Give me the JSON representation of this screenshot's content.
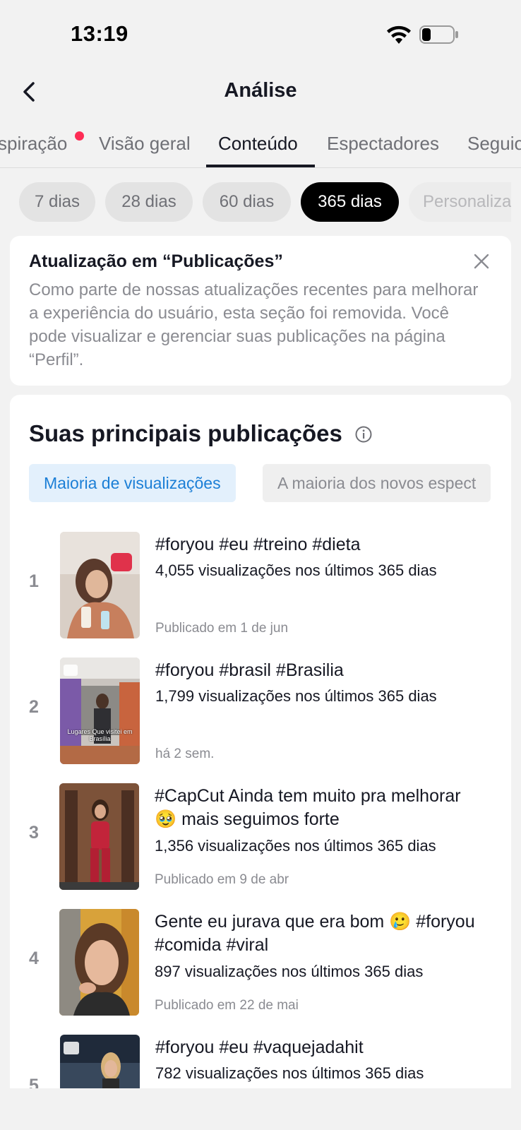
{
  "status": {
    "time": "13:19"
  },
  "header": {
    "title": "Análise"
  },
  "tabs": [
    {
      "label": "spiração",
      "active": false,
      "has_dot": true
    },
    {
      "label": "Visão geral",
      "active": false
    },
    {
      "label": "Conteúdo",
      "active": true
    },
    {
      "label": "Espectadores",
      "active": false
    },
    {
      "label": "Seguio",
      "active": false
    }
  ],
  "ranges": [
    {
      "label": "7 dias"
    },
    {
      "label": "28 dias"
    },
    {
      "label": "60 dias"
    },
    {
      "label": "365 dias",
      "active": true
    },
    {
      "label": "Personaliza"
    }
  ],
  "notice": {
    "title": "Atualização em “Publicações”",
    "body": "Como parte de nossas atualizações recentes para melhorar a experiência do usuário, esta seção foi removida. Você pode visualizar e gerenciar suas publicações na página “Perfil”."
  },
  "top_posts": {
    "title": "Suas principais publicações",
    "filters": [
      "Maioria de visualizações",
      "A maioria dos novos espect"
    ],
    "items": [
      {
        "rank": "1",
        "title": "#foryou #eu #treino #dieta",
        "views": "4,055 visualizações nos últimos 365 dias",
        "date": "Publicado em 1 de jun"
      },
      {
        "rank": "2",
        "title": "#foryou #brasil #Brasilia",
        "views": "1,799 visualizações nos últimos 365 dias",
        "date": "há 2 sem.",
        "thumb_caption": "Lugares Que visitei em Brasília"
      },
      {
        "rank": "3",
        "title": "#CapCut Ainda tem muito pra melhorar 🥹 mais seguimos forte",
        "views": "1,356 visualizações nos últimos 365 dias",
        "date": "Publicado em 9 de abr"
      },
      {
        "rank": "4",
        "title": "Gente eu jurava que era bom 🥲 #foryou #comida #viral",
        "views": "897 visualizações nos últimos 365 dias",
        "date": "Publicado em 22 de mai"
      },
      {
        "rank": "5",
        "title": "#foryou #eu #vaquejadahit",
        "views": "782 visualizações nos últimos 365 dias",
        "date": ""
      }
    ]
  },
  "colors": {
    "accent": "#fe2c55",
    "filter_active": "#1c7fd6",
    "text_primary": "#161823",
    "text_secondary": "#8a8b91"
  }
}
